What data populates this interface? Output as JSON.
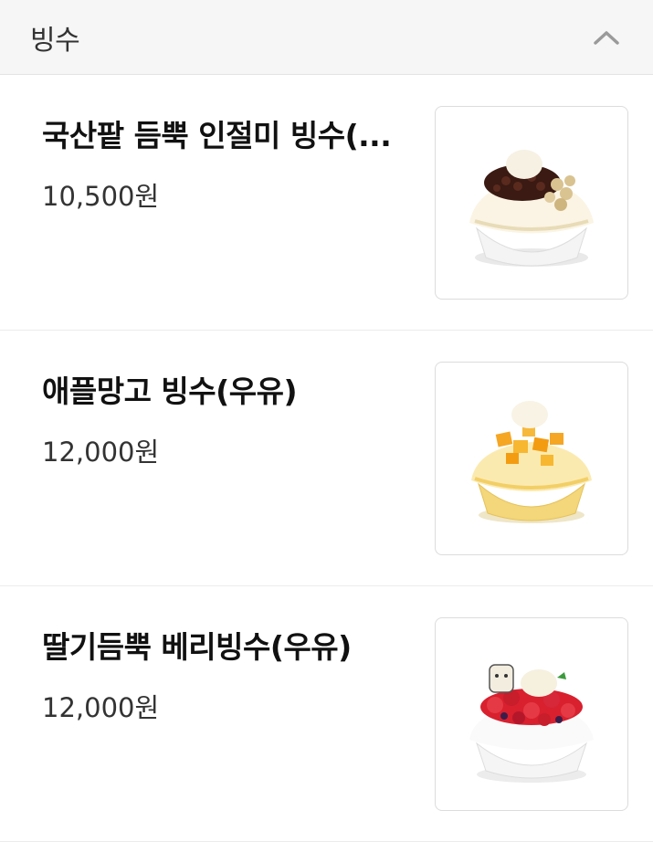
{
  "section": {
    "title": "빙수"
  },
  "items": [
    {
      "name": "국산팥 듬뿍 인절미 빙수(...",
      "price": "10,500원",
      "image": "red-bean-injeolmi-bingsu"
    },
    {
      "name": "애플망고 빙수(우유)",
      "price": "12,000원",
      "image": "apple-mango-bingsu"
    },
    {
      "name": "딸기듬뿍 베리빙수(우유)",
      "price": "12,000원",
      "image": "strawberry-berry-bingsu"
    }
  ]
}
